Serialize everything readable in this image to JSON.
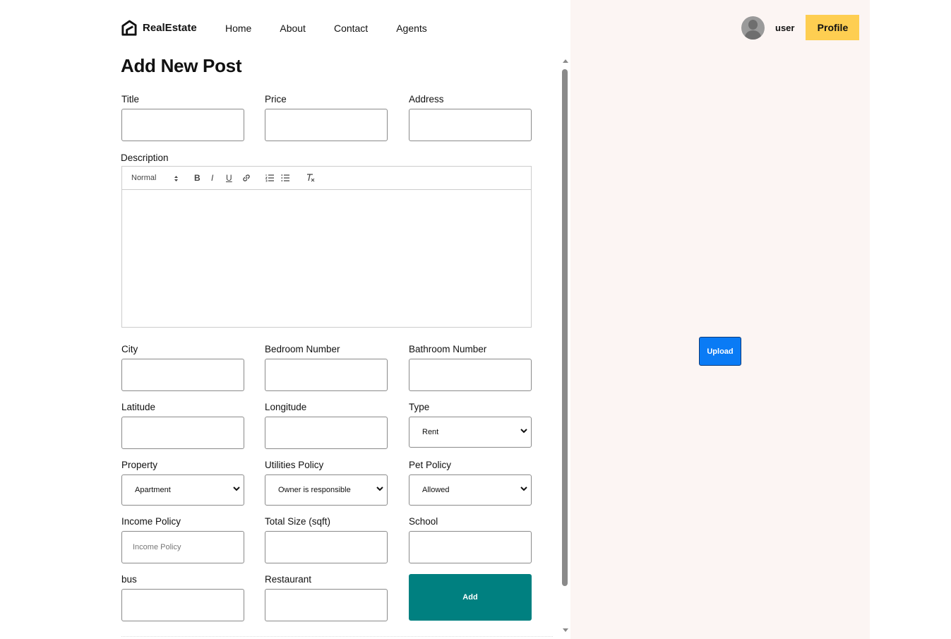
{
  "brand": {
    "name": "RealEstate"
  },
  "nav": {
    "home": "Home",
    "about": "About",
    "contact": "Contact",
    "agents": "Agents"
  },
  "user": {
    "name": "user",
    "profile_label": "Profile"
  },
  "page": {
    "title": "Add New Post"
  },
  "form": {
    "title_label": "Title",
    "price_label": "Price",
    "address_label": "Address",
    "description_label": "Description",
    "editor": {
      "format_select": "Normal",
      "bold": "B",
      "italic": "I",
      "underline": "U"
    },
    "city_label": "City",
    "bedroom_label": "Bedroom Number",
    "bathroom_label": "Bathroom Number",
    "latitude_label": "Latitude",
    "longitude_label": "Longitude",
    "type_label": "Type",
    "type_value": "Rent",
    "property_label": "Property",
    "property_value": "Apartment",
    "utilities_label": "Utilities Policy",
    "utilities_value": "Owner is responsible",
    "pet_label": "Pet Policy",
    "pet_value": "Allowed",
    "income_label": "Income Policy",
    "income_placeholder": "Income Policy",
    "size_label": "Total Size (sqft)",
    "school_label": "School",
    "bus_label": "bus",
    "restaurant_label": "Restaurant",
    "add_label": "Add"
  },
  "upload": {
    "label": "Upload"
  },
  "colors": {
    "accent_yellow": "#fece51",
    "add_button": "#008080",
    "upload_button": "#0a7bf5",
    "right_panel": "#fcf5f3"
  }
}
